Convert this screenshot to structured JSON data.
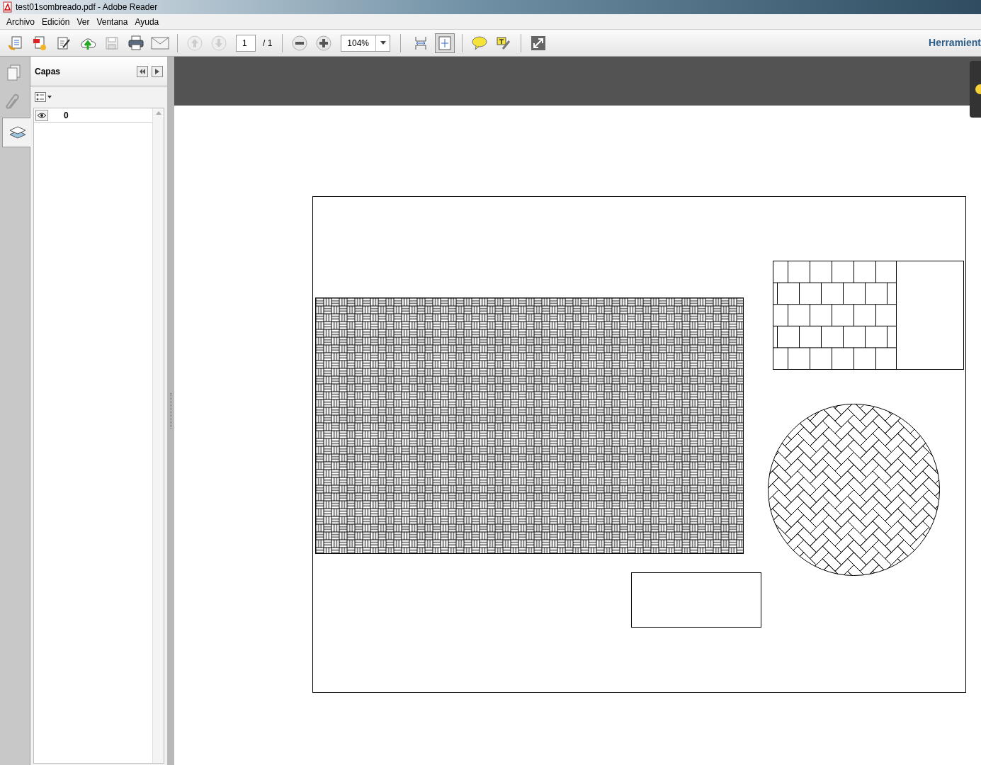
{
  "window": {
    "title": "test01sombreado.pdf - Adobe Reader"
  },
  "menu": [
    "Archivo",
    "Edición",
    "Ver",
    "Ventana",
    "Ayuda"
  ],
  "toolbar": {
    "page_number": "1",
    "page_total": "/ 1",
    "zoom": "104%",
    "tools_label": "Herramient"
  },
  "side_tabs": [
    {
      "kind": "pages",
      "selected": false
    },
    {
      "kind": "attachments",
      "selected": false
    },
    {
      "kind": "layers",
      "selected": true
    }
  ],
  "layers_panel": {
    "title": "Capas",
    "layers": [
      {
        "name": "0",
        "visible": true
      }
    ]
  }
}
